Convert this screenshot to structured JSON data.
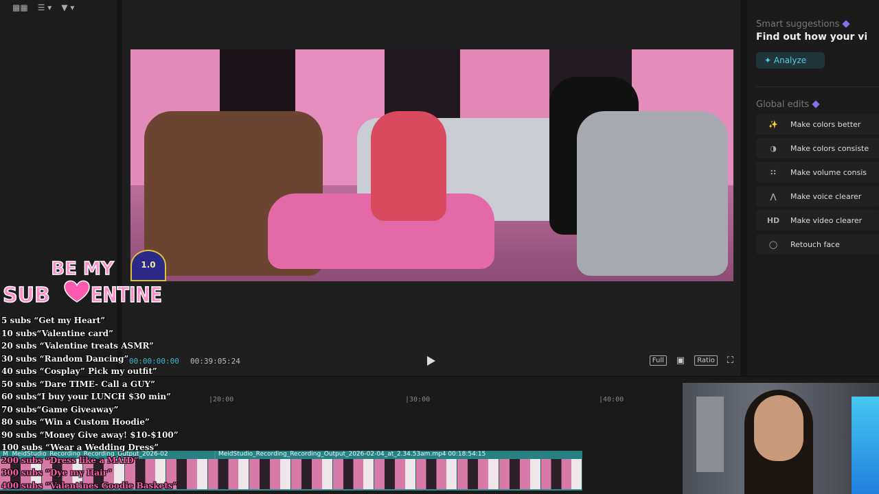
{
  "toolbar": {
    "icons": [
      "grid-view-icon",
      "sort-icon",
      "filter-icon"
    ]
  },
  "player": {
    "current_time": "00:00:00:00",
    "duration": "00:39:05:24",
    "full_label": "Full",
    "ratio_label": "Ratio"
  },
  "preview": {
    "badge_text": "1.0"
  },
  "ai_panel": {
    "smart_label": "Smart suggestions",
    "find_text": "Find out how your vi",
    "analyze_label": "Analyze",
    "global_label": "Global edits",
    "edits": [
      {
        "label": "Make colors better",
        "icon": "magic-icon"
      },
      {
        "label": "Make colors consiste",
        "icon": "palette-icon"
      },
      {
        "label": "Make volume consis",
        "icon": "volume-icon"
      },
      {
        "label": "Make voice clearer",
        "icon": "voice-icon"
      },
      {
        "label": "Make video clearer",
        "icon": "hd-icon",
        "icon_text": "HD"
      },
      {
        "label": "Retouch face",
        "icon": "face-icon"
      }
    ]
  },
  "timeline": {
    "ruler": [
      "|20:00",
      "|30:00",
      "|40:00"
    ],
    "clip1_label": "MeidStudio_Recording_Recording_Output_2026-02",
    "clip2_label": "MeidStudio_Recording_Recording_Output_2026-02-04_at_2.34.53am.mp4   00:18:54:15",
    "clip1_prefix": "M"
  },
  "overlay": {
    "logo_line1": "BE MY",
    "logo_line2": "SUB",
    "logo_line3": "ENTINE",
    "goals": [
      "5 subs “Get my Heart”",
      "10 subs“Valentine card”",
      "20 subs “Valentine treats ASMR”",
      "30 subs “Random Dancing”",
      "40 subs “Cosplay” Pick my outfit”",
      "50 subs “Dare TIME- Call a GUY”",
      "60 subs“I buy your LUNCH $30 min”",
      "70 subs“Game Giveaway”",
      "80 subs “Win a Custom Hoodie”",
      "90 subs “Money Give away! $10-$100”",
      "100 subs “Wear a Wedding Dress”",
      "200 subs “Dress like a MAID”",
      "300 subs “Dye my Hair”",
      "400 subs “Valentines Goodie Baskets”"
    ]
  },
  "colors": {
    "accent": "#3fb7c7",
    "gem": "#8a6cf0",
    "clip": "#2f8f8c",
    "overlay_pink": "#ff5ab0"
  }
}
